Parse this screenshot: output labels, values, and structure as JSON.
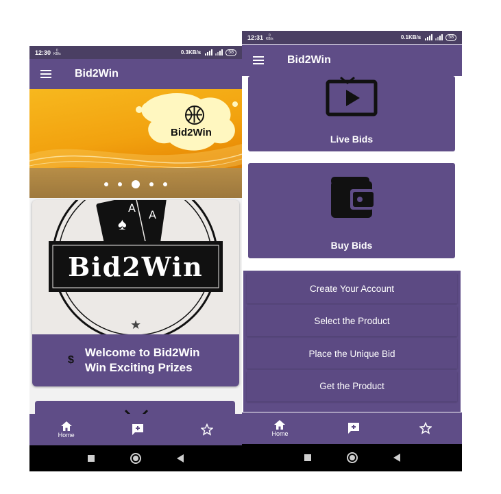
{
  "colors": {
    "primary": "#5f4d87",
    "status_bar": "#4a3f63",
    "banner_accent": "#f2a20f"
  },
  "left_phone": {
    "status": {
      "time": "12:30",
      "network_speed": "0.3KB/s",
      "kbs_top": "0",
      "kbs_bottom": "KB/s",
      "battery": "58"
    },
    "app_bar": {
      "title": "Bid2Win",
      "menu_icon": "hamburger-menu-icon"
    },
    "banner": {
      "logo_text": "Bid2Win",
      "logo_icon": "basketball-icon",
      "slide_count": 5,
      "active_slide": 3
    },
    "logo_card": {
      "logo_text": "Bid2Win",
      "card_corner_letter": "A",
      "card_icon": "ace-of-spades-icon",
      "caption_icon": "dollar-icon",
      "caption_symbol": "$",
      "caption_line1": "Welcome to Bid2Win",
      "caption_line2": "Win Exciting Prizes"
    },
    "bottom_nav": {
      "home_label": "Home",
      "items": [
        "home-icon",
        "add-comment-icon",
        "star-outline-icon"
      ]
    },
    "system_nav": [
      "recents-square-icon",
      "home-circle-icon",
      "back-triangle-icon"
    ]
  },
  "right_phone": {
    "status": {
      "time": "12:31",
      "network_speed": "0.1KB/s",
      "kbs_top": "0",
      "kbs_bottom": "KB/s",
      "battery": "58"
    },
    "app_bar": {
      "title": "Bid2Win",
      "menu_icon": "hamburger-menu-icon"
    },
    "features": [
      {
        "label": "Live Bids",
        "icon": "live-tv-play-icon"
      },
      {
        "label": "Buy Bids",
        "icon": "wallet-icon"
      }
    ],
    "steps": [
      "Create Your Account",
      "Select the Product",
      "Place the Unique Bid",
      "Get the Product"
    ],
    "bottom_nav": {
      "home_label": "Home",
      "items": [
        "home-icon",
        "add-comment-icon",
        "star-outline-icon"
      ]
    },
    "system_nav": [
      "recents-square-icon",
      "home-circle-icon",
      "back-triangle-icon"
    ]
  }
}
